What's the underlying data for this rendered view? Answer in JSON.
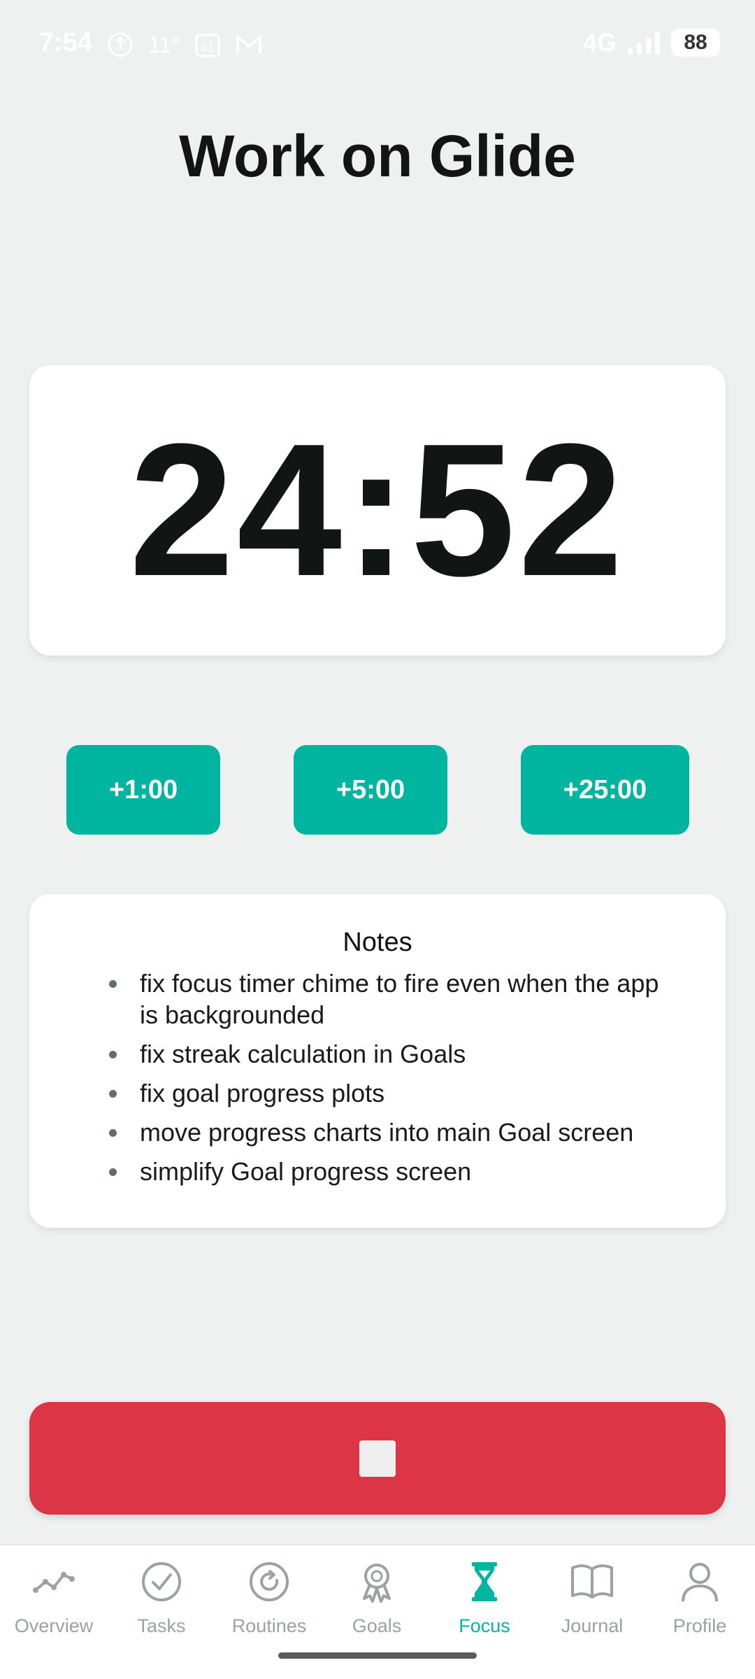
{
  "status_bar": {
    "time": "7:54",
    "temperature": "11°",
    "calendar_day": "31",
    "network": "4G",
    "battery": "88"
  },
  "page": {
    "title": "Work on Glide"
  },
  "timer": {
    "value": "24:52"
  },
  "add_time_buttons": [
    "+1:00",
    "+5:00",
    "+25:00"
  ],
  "notes": {
    "title": "Notes",
    "items": [
      "fix focus timer chime to fire even when the app is backgrounded",
      "fix streak calculation in Goals",
      "fix goal progress plots",
      "move progress charts into main Goal screen",
      "simplify Goal progress screen"
    ]
  },
  "bottom_nav": {
    "active": "Focus",
    "items": [
      {
        "label": "Overview",
        "icon": "chart-line-icon"
      },
      {
        "label": "Tasks",
        "icon": "check-circle-icon"
      },
      {
        "label": "Routines",
        "icon": "refresh-circle-icon"
      },
      {
        "label": "Goals",
        "icon": "award-ribbon-icon"
      },
      {
        "label": "Focus",
        "icon": "hourglass-icon"
      },
      {
        "label": "Journal",
        "icon": "open-book-icon"
      },
      {
        "label": "Profile",
        "icon": "person-icon"
      }
    ]
  },
  "colors": {
    "accent": "#00b5a0",
    "stop": "#dc3545",
    "background": "#eff1f1",
    "nav_inactive": "#9aa3a0"
  }
}
